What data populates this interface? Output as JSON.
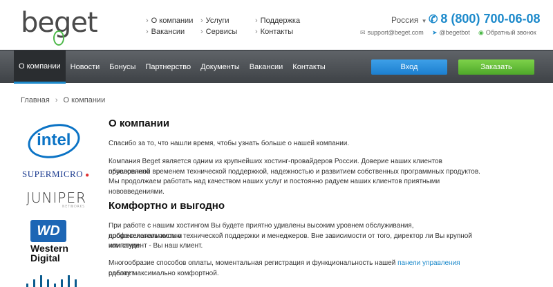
{
  "brand": {
    "logo_text": "beget"
  },
  "top_links": {
    "col1": [
      "О компании",
      "Вакансии"
    ],
    "col2": [
      "Услуги",
      "Сервисы"
    ],
    "col3": [
      "Поддержка",
      "Контакты"
    ]
  },
  "region": {
    "label": "Россия"
  },
  "phone": "8 (800) 700-06-08",
  "contacts": {
    "email": "support@beget.com",
    "telegram": "@begetbot",
    "callback": "Обратный звонок"
  },
  "nav": {
    "items": [
      "О компании",
      "Новости",
      "Бонусы",
      "Партнерство",
      "Документы",
      "Вакансии",
      "Контакты"
    ],
    "active_index": 0,
    "login_label": "Вход",
    "order_label": "Заказать"
  },
  "breadcrumb": {
    "home": "Главная",
    "current": "О компании"
  },
  "partners": {
    "intel": "intel",
    "supermicro": "SUPERMICRO",
    "juniper": "JUNIPER",
    "juniper_sub": "NETWORKS",
    "wd_box": "WD",
    "wd_line1": "Western",
    "wd_line2": "Digital"
  },
  "main": {
    "h1": "О компании",
    "p1": "Спасибо за то, что нашли время, чтобы узнать больше о нашей компании.",
    "p2_line1": "Компания Beget является одним из крупнейших хостинг-провайдеров России. Доверие наших клиентов обусловлено",
    "p2_line2": "проверенной временем технической поддержкой, надежностью и развитием собственных программных продуктов.",
    "p2_line3": "Мы продолжаем работать над качеством наших услуг и постоянно радуем наших клиентов приятными нововведениями.",
    "h2": "Комфортно и выгодно",
    "p3_line1": "При работе с нашим хостингом Вы будете приятно удивлены высоким уровнем обслуживания, профессионализмом и",
    "p3_line2": "доброжелательностью технической поддержки и менеджеров. Вне зависимости от того, директор ли Вы крупной компании",
    "p3_line3": "или студент - Вы наш клиент.",
    "p4_pre": "Многообразие способов оплаты, моментальная регистрация и функциональность нашей",
    "p4_link": "панели управления",
    "p4_post": "сделает",
    "p4_line2": "работу максимально комфортной."
  }
}
